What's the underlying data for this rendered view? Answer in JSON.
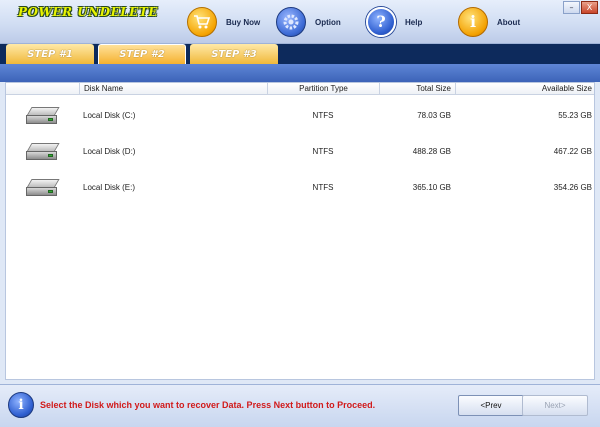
{
  "app": {
    "title": "POWER UNDELETE"
  },
  "window_controls": {
    "minimize": "–",
    "close": "X"
  },
  "toolbar": {
    "buy_label": "Buy Now",
    "option_label": "Option",
    "help_label": "Help",
    "about_label": "About"
  },
  "steps": {
    "step1": "STEP #1",
    "step2": "STEP #2",
    "step3": "STEP #3",
    "active": "step2"
  },
  "table": {
    "headers": {
      "disk_name": "Disk Name",
      "partition_type": "Partition Type",
      "total_size": "Total Size",
      "available_size": "Available Size"
    },
    "rows": [
      {
        "disk_name": "Local Disk (C:)",
        "partition_type": "NTFS",
        "total_size": "78.03 GB",
        "available_size": "55.23 GB"
      },
      {
        "disk_name": "Local Disk (D:)",
        "partition_type": "NTFS",
        "total_size": "488.28 GB",
        "available_size": "467.22 GB"
      },
      {
        "disk_name": "Local Disk (E:)",
        "partition_type": "NTFS",
        "total_size": "365.10 GB",
        "available_size": "354.26 GB"
      }
    ]
  },
  "status": {
    "message": "Select the Disk which you want to recover Data. Press Next button to Proceed."
  },
  "nav": {
    "prev_label": "<Prev",
    "next_label": "Next>"
  },
  "icons": {
    "buy": "shopping-cart-icon",
    "option": "gear-icon",
    "help": "question-mark-icon",
    "about": "info-icon",
    "disk": "hard-disk-icon",
    "status": "info-icon"
  },
  "colors": {
    "tab_active": "#f5b12f",
    "tab_bar": "#0d2a5c",
    "status_text": "#d11a1a",
    "title_text": "#e8f400"
  }
}
